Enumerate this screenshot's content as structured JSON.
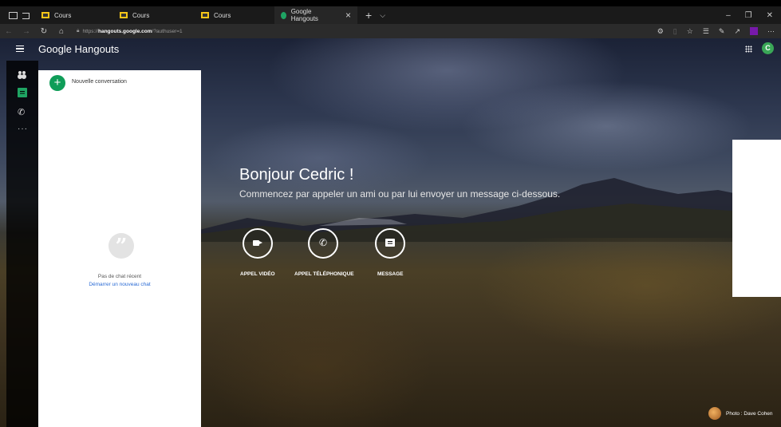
{
  "browser": {
    "tabs": [
      {
        "label": "Cours"
      },
      {
        "label": "Cours"
      },
      {
        "label": "Cours"
      },
      {
        "label": "Google Hangouts",
        "active": true
      }
    ],
    "url_prefix": "https://",
    "url_host": "hangouts.google.com",
    "url_path": "/?authuser=1"
  },
  "app": {
    "brand_regular": "Google",
    "brand_bold": "Hangouts",
    "avatar_letter": "C",
    "accent": "#0f9d58"
  },
  "conversations": {
    "new_label": "Nouvelle conversation",
    "empty_title": "Pas de chat récent",
    "empty_link": "Démarrer un nouveau chat"
  },
  "welcome": {
    "greeting": "Bonjour Cedric !",
    "subtitle": "Commencez par appeler un ami ou par lui envoyer un message ci-dessous.",
    "actions": [
      {
        "label": "APPEL VIDÉO",
        "icon": "video-camera-icon"
      },
      {
        "label": "APPEL TÉLÉPHONIQUE",
        "icon": "phone-icon"
      },
      {
        "label": "MESSAGE",
        "icon": "message-icon"
      }
    ]
  },
  "photo_credit": "Photo : Dave Cohen"
}
